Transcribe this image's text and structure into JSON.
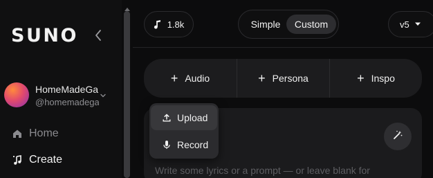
{
  "sidebar": {
    "logo": "SUNO",
    "user": {
      "name": "HomeMadeGa",
      "handle": "@homemadega"
    },
    "nav": [
      {
        "label": "Home",
        "icon": "home-icon"
      },
      {
        "label": "Create",
        "icon": "create-music-icon"
      }
    ]
  },
  "header": {
    "credits": "1.8k",
    "mode": {
      "simple": "Simple",
      "custom": "Custom",
      "selected": "Custom"
    },
    "version": "v5"
  },
  "add_bar": {
    "audio": "Audio",
    "persona": "Persona",
    "inspo": "Inspo"
  },
  "audio_menu": {
    "upload": "Upload",
    "record": "Record"
  },
  "editor": {
    "placeholder": "Write some lyrics or a prompt — or leave blank for"
  },
  "colors": {
    "background": "#0c0c0d",
    "surface": "#1c1c1e",
    "menu": "#2b2b2e",
    "selected_pill": "#2d2d30"
  }
}
